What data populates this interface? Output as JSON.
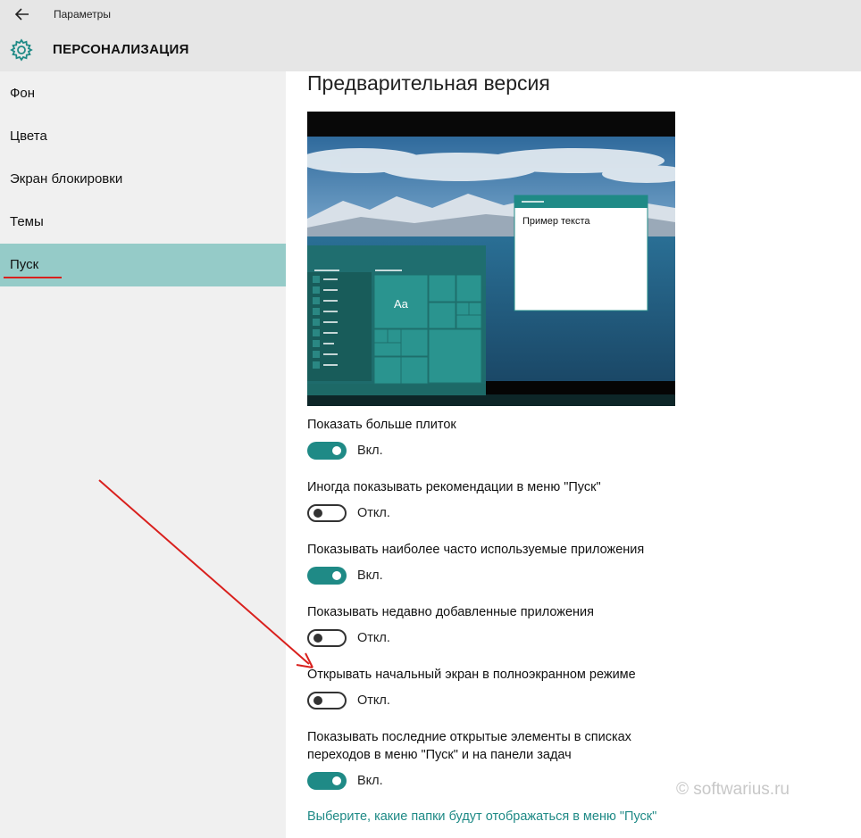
{
  "window": {
    "app_title": "Параметры",
    "section_title": "ПЕРСОНАЛИЗАЦИЯ"
  },
  "sidebar": {
    "items": [
      {
        "label": "Фон"
      },
      {
        "label": "Цвета"
      },
      {
        "label": "Экран блокировки"
      },
      {
        "label": "Темы"
      },
      {
        "label": "Пуск",
        "active": true
      }
    ]
  },
  "main": {
    "heading": "Предварительная версия",
    "preview": {
      "sample_text": "Пример текста",
      "tile_text": "Aa"
    },
    "options": [
      {
        "label": "Показать больше плиток",
        "state": "Вкл.",
        "on": true
      },
      {
        "label": "Иногда показывать рекомендации в меню \"Пуск\"",
        "state": "Откл.",
        "on": false
      },
      {
        "label": "Показывать наиболее часто используемые приложения",
        "state": "Вкл.",
        "on": true
      },
      {
        "label": "Показывать недавно добавленные приложения",
        "state": "Откл.",
        "on": false
      },
      {
        "label": "Открывать начальный экран в полноэкранном режиме",
        "state": "Откл.",
        "on": false
      },
      {
        "label_line1": "Показывать последние открытые элементы в списках",
        "label_line2": "переходов в меню \"Пуск\" и на панели задач",
        "state": "Вкл.",
        "on": true
      }
    ],
    "folders_link": "Выберите, какие папки будут отображаться в меню \"Пуск\""
  },
  "watermark": "© softwarius.ru",
  "colors": {
    "accent": "#1f8a86",
    "active_nav": "#95cbc8",
    "annotation": "#d9201d"
  }
}
